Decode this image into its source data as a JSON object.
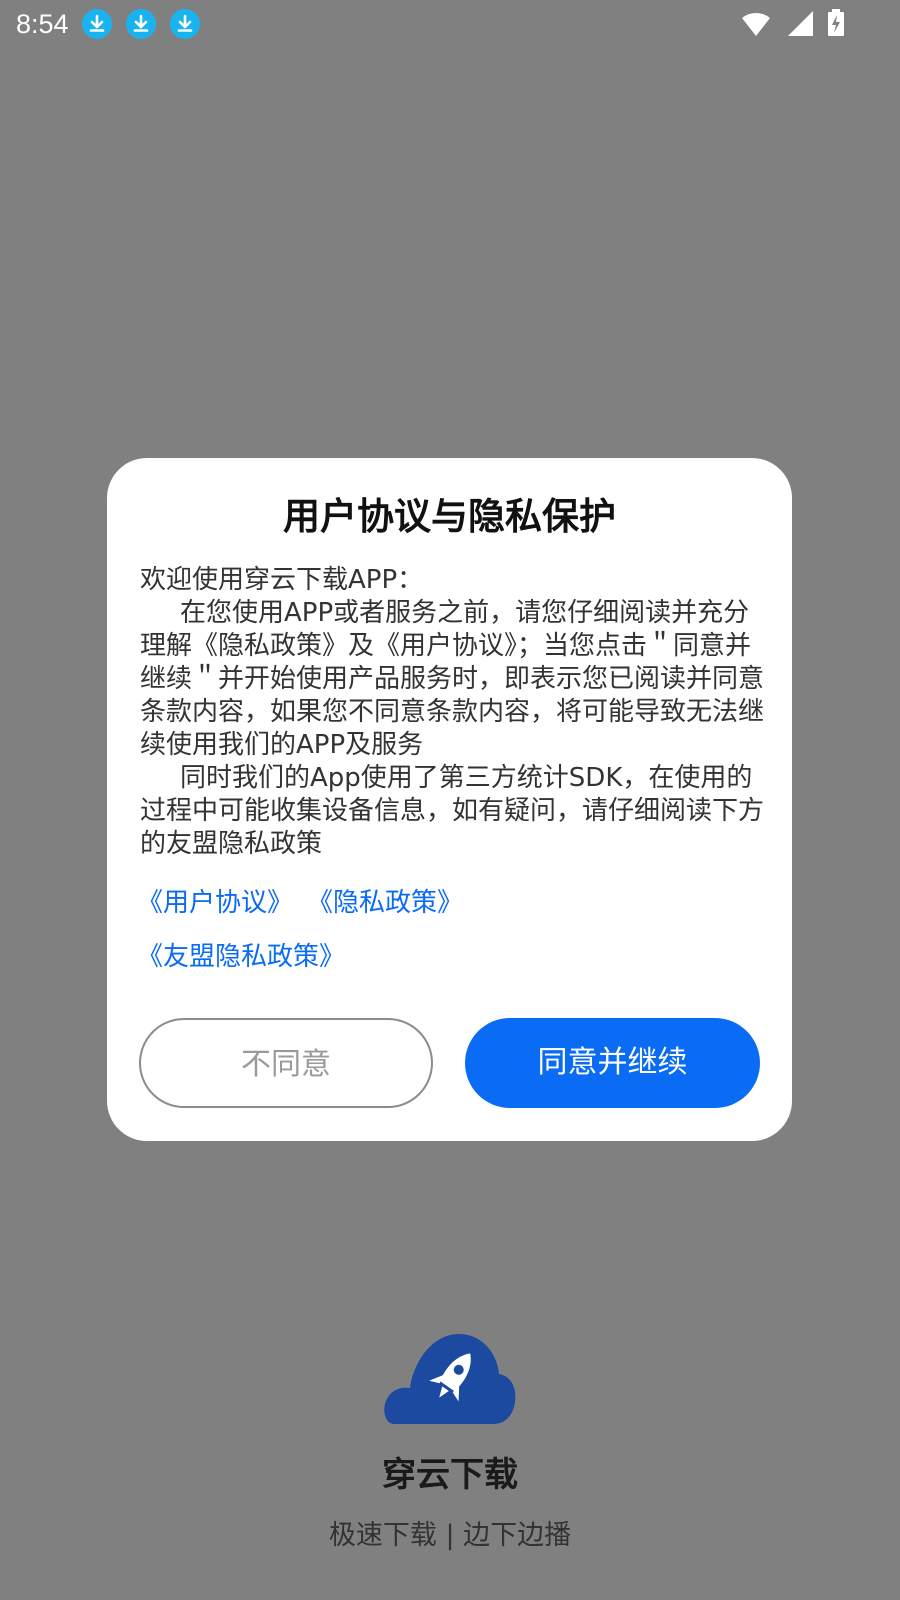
{
  "status_bar": {
    "time": "8:54",
    "notification_icons": [
      "download-icon",
      "download-icon",
      "download-icon"
    ],
    "right_icons": [
      "wifi-icon",
      "signal-icon",
      "battery-charging-icon"
    ]
  },
  "dialog": {
    "title": "用户协议与隐私保护",
    "greeting": "欢迎使用穿云下载APP：",
    "paragraph1": "在您使用APP或者服务之前，请您仔细阅读并充分理解《隐私政策》及《用户协议》；当您点击＂同意并继续＂并开始使用产品服务时，即表示您已阅读并同意条款内容，如果您不同意条款内容，将可能导致无法继续使用我们的APP及服务",
    "paragraph2": "同时我们的App使用了第三方统计SDK，在使用的过程中可能收集设备信息，如有疑问，请仔细阅读下方的友盟隐私政策",
    "links": {
      "user_agreement": "《用户协议》",
      "privacy_policy": "《隐私政策》",
      "umeng_privacy": "《友盟隐私政策》"
    },
    "buttons": {
      "disagree": "不同意",
      "agree": "同意并继续"
    }
  },
  "splash": {
    "app_name": "穿云下载",
    "slogan": "极速下载 | 边下边播"
  },
  "colors": {
    "overlay": "#808080",
    "accent": "#0a6cf5",
    "logo": "#1b4aa0",
    "download_icon": "#19b4f0"
  }
}
